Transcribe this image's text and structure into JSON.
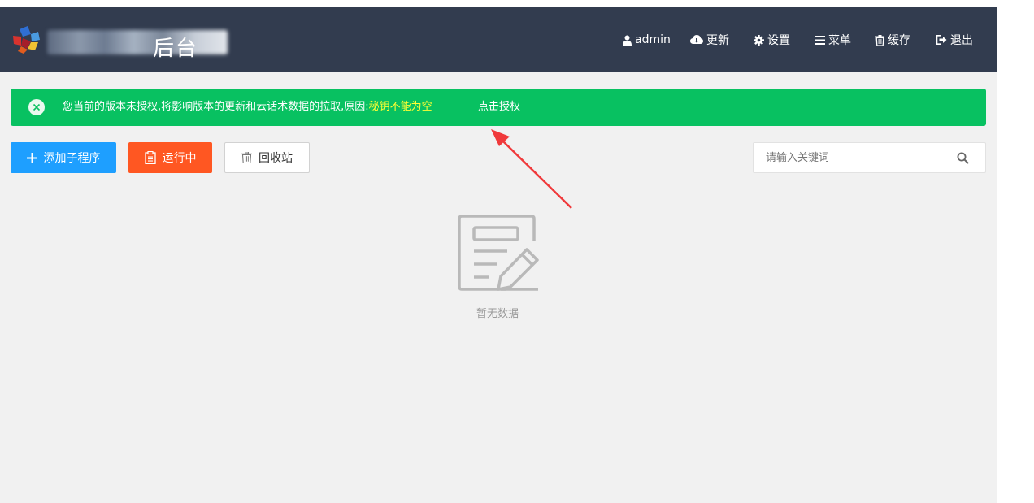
{
  "header": {
    "brand_title": "后台",
    "nav": {
      "user": "admin",
      "update": "更新",
      "settings": "设置",
      "menu": "菜单",
      "cache": "缓存",
      "logout": "退出"
    }
  },
  "alert": {
    "message": "您当前的版本未授权,将影响版本的更新和云话术数据的拉取,原因:",
    "reason": "秘钥不能为空",
    "link": "点击授权"
  },
  "toolbar": {
    "add_label": "添加子程序",
    "running_label": "运行中",
    "recycle_label": "回收站"
  },
  "search": {
    "placeholder": "请输入关键词",
    "value": ""
  },
  "empty": {
    "text": "暂无数据"
  },
  "colors": {
    "header_bg": "#323c4f",
    "alert_bg": "#08c161",
    "alert_reason": "#ffff33",
    "add_button": "#1e9fff",
    "running_button": "#ff5722",
    "annotation_arrow": "#f0393b"
  },
  "icons": [
    "logo-icon",
    "user-icon",
    "cloud-download-icon",
    "gear-icon",
    "bars-icon",
    "trash-icon",
    "sign-out-icon",
    "close-circle-icon",
    "plus-icon",
    "clipboard-icon",
    "search-icon",
    "empty-document-icon"
  ]
}
